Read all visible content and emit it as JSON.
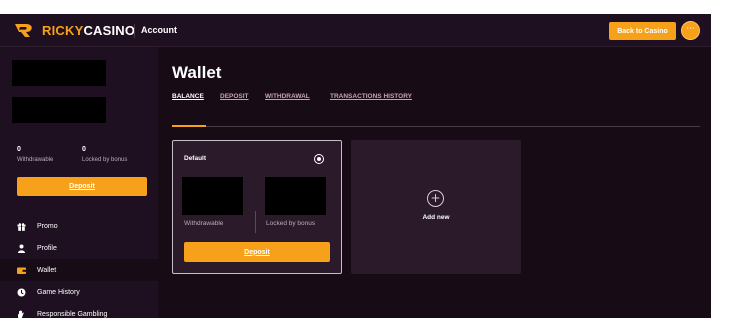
{
  "header": {
    "brand_part1": "RICKY",
    "brand_part2": "CASINO",
    "section": "Account",
    "back_button": "Back to Casino",
    "more_button": "···"
  },
  "sidebar": {
    "withdrawable_value": "0",
    "withdrawable_label": "Withdrawable",
    "locked_value": "0",
    "locked_label": "Locked by bonus",
    "deposit_button": "Deposit",
    "nav": [
      {
        "label": "Promo",
        "icon": "gift-icon",
        "active": false
      },
      {
        "label": "Profile",
        "icon": "user-icon",
        "active": false
      },
      {
        "label": "Wallet",
        "icon": "wallet-icon",
        "active": true
      },
      {
        "label": "Game History",
        "icon": "clock-icon",
        "active": false
      },
      {
        "label": "Responsible Gambling",
        "icon": "hand-icon",
        "active": false
      }
    ]
  },
  "main": {
    "title": "Wallet",
    "tabs": [
      {
        "label": "BALANCE",
        "active": true
      },
      {
        "label": "DEPOSIT",
        "active": false
      },
      {
        "label": "WITHDRAWAL",
        "active": false
      },
      {
        "label": "TRANSACTIONS HISTORY",
        "active": false
      }
    ],
    "wallet_card": {
      "title": "Default",
      "withdrawable_label": "Withdrawable",
      "locked_label": "Locked by bonus",
      "deposit_button": "Deposit"
    },
    "add_card": {
      "plus": "+",
      "label": "Add new"
    }
  },
  "colors": {
    "accent": "#f7a11a",
    "background": "#170c16",
    "panel": "#1e1020",
    "card": "#2a1a2a",
    "tab_inactive": "#c89fb8"
  }
}
